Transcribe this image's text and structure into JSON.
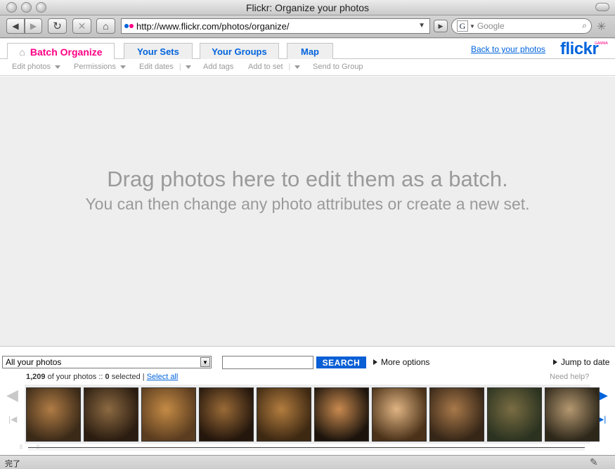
{
  "window": {
    "title": "Flickr: Organize your photos"
  },
  "toolbar": {
    "url": "http://www.flickr.com/photos/organize/",
    "search_placeholder": "Google",
    "search_engine_letter": "G"
  },
  "tabs": [
    {
      "label": "Batch Organize",
      "active": true
    },
    {
      "label": "Your Sets",
      "active": false
    },
    {
      "label": "Your Groups",
      "active": false
    },
    {
      "label": "Map",
      "active": false
    }
  ],
  "header": {
    "back_link": "Back to your photos",
    "logo": "flickr",
    "logo_badge": "GAMMA"
  },
  "actions": [
    {
      "label": "Edit photos",
      "menu": true
    },
    {
      "label": "Permissions",
      "menu": true
    },
    {
      "label": "Edit dates",
      "menu": true
    },
    {
      "label": "Add tags",
      "menu": false
    },
    {
      "label": "Add to set",
      "menu": true
    },
    {
      "label": "Send to Group",
      "menu": false
    }
  ],
  "batch": {
    "headline": "Drag photos here to edit them as a batch.",
    "subline": "You can then change any photo attributes or create a new set."
  },
  "organizer": {
    "filter_value": "All your photos",
    "search_button": "SEARCH",
    "search_value": "",
    "more_options": "More options",
    "jump_to_date": "Jump to date",
    "photo_count": "1,209",
    "count_suffix": "of your photos ::",
    "selected_count": "0",
    "selected_suffix": "selected |",
    "select_all": "Select all",
    "need_help": "Need help?"
  },
  "thumbnails": [
    {
      "name": "photo-thumbnail-1",
      "colors": [
        "#3b2a18",
        "#b07c45"
      ]
    },
    {
      "name": "photo-thumbnail-2",
      "colors": [
        "#2a1c10",
        "#8c6a42"
      ]
    },
    {
      "name": "photo-thumbnail-3",
      "colors": [
        "#5a3c1f",
        "#c58b45"
      ]
    },
    {
      "name": "photo-thumbnail-4",
      "colors": [
        "#24160c",
        "#9a6b37"
      ]
    },
    {
      "name": "photo-thumbnail-5",
      "colors": [
        "#3d2812",
        "#b37d3f"
      ]
    },
    {
      "name": "photo-thumbnail-6",
      "colors": [
        "#1c140c",
        "#c98a4f"
      ]
    },
    {
      "name": "photo-thumbnail-7",
      "colors": [
        "#4a3118",
        "#e0b483"
      ]
    },
    {
      "name": "photo-thumbnail-8",
      "colors": [
        "#362617",
        "#a9794a"
      ]
    },
    {
      "name": "photo-thumbnail-9",
      "colors": [
        "#2b3320",
        "#7a6d43"
      ]
    },
    {
      "name": "photo-thumbnail-10",
      "colors": [
        "#2d271a",
        "#b59870"
      ]
    }
  ],
  "status": {
    "text": "完了"
  },
  "colors": {
    "flickr_blue": "#0063dc",
    "flickr_pink": "#ff0084",
    "search_button": "#0a5fd5"
  },
  "icons": [
    "back-icon",
    "forward-icon",
    "reload-icon",
    "stop-icon",
    "home-icon",
    "flickr-favicon",
    "rss-icon",
    "search-icon",
    "spinner-icon",
    "home-tab-icon",
    "prev-icon",
    "next-icon",
    "first-icon",
    "last-icon",
    "edit-icon"
  ]
}
